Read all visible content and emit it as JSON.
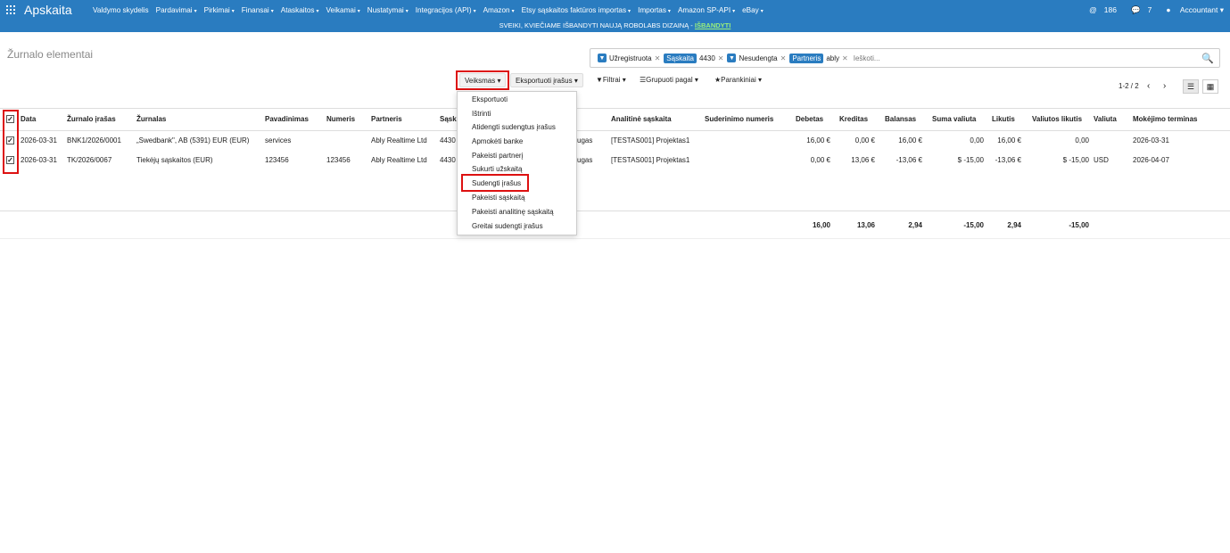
{
  "topbar": {
    "app_title": "Apskaita",
    "menu": [
      "Valdymo skydelis",
      "Pardavimai",
      "Pirkimai",
      "Finansai",
      "Ataskaitos",
      "Veikamai",
      "Nustatymai",
      "Integracijos (API)",
      "Amazon",
      "Etsy sąskaitos faktūros importas",
      "Importas",
      "Amazon SP-API",
      "eBay"
    ],
    "notifications": "186",
    "messages": "7",
    "user": "Accountant"
  },
  "banner": {
    "text": "SVEIKI, KVIEČIAME IŠBANDYTI NAUJĄ ROBOLABS DIZAINĄ -",
    "link": "IŠBANDYTI"
  },
  "page": {
    "breadcrumb": "Žurnalo elementai"
  },
  "search": {
    "facets": [
      {
        "type": "filter",
        "value": "Užregistruota"
      },
      {
        "type": "field",
        "label": "Sąskaita",
        "value": "4430"
      },
      {
        "type": "filter",
        "value": "Nesudengta"
      },
      {
        "type": "field",
        "label": "Partneris",
        "value": "ably"
      }
    ],
    "placeholder": "Ieškoti..."
  },
  "toolbar": {
    "actions": "Veiksmas",
    "export": "Eksportuoti įrašus",
    "filters": "Filtrai",
    "group_by": "Grupuoti pagal",
    "favorites": "Parankiniai"
  },
  "pager": {
    "text": "1-2 / 2"
  },
  "table": {
    "headers": {
      "date": "Data",
      "entry": "Žurnalo įrašas",
      "journal": "Žurnalas",
      "name": "Pavadinimas",
      "number": "Numeris",
      "partner": "Partneris",
      "account": "Sąsk",
      "analytic": "Analitinė sąskaita",
      "reconcile": "Suderinimo numeris",
      "debit": "Debetas",
      "credit": "Kreditas",
      "balance": "Balansas",
      "amount_currency": "Suma valiuta",
      "residual": "Likutis",
      "residual_currency": "Valiutos likutis",
      "currency": "Valiuta",
      "due": "Mokėjimo terminas"
    },
    "rows": [
      {
        "date": "2026-03-31",
        "entry": "BNK1/2026/0001",
        "journal": "„Swedbank\", AB (5391) EUR (EUR)",
        "name": "services",
        "number": "",
        "partner": "Ably Realtime Ltd",
        "account": "4430",
        "account_tail": "ugas",
        "analytic": "[TESTAS001] Projektas1",
        "reconcile": "",
        "debit": "16,00 €",
        "credit": "0,00 €",
        "balance": "16,00 €",
        "amount_currency": "0,00",
        "residual": "16,00 €",
        "residual_currency": "0,00",
        "currency": "",
        "due": "2026-03-31"
      },
      {
        "date": "2026-03-31",
        "entry": "TK/2026/0067",
        "journal": "Tiekėjų sąskaitos (EUR)",
        "name": "123456",
        "number": "123456",
        "partner": "Ably Realtime Ltd",
        "account": "4430",
        "account_tail": "ugas",
        "analytic": "[TESTAS001] Projektas1",
        "reconcile": "",
        "debit": "0,00 €",
        "credit": "13,06 €",
        "balance": "-13,06 €",
        "amount_currency": "$ -15,00",
        "residual": "-13,06 €",
        "residual_currency": "$ -15,00",
        "currency": "USD",
        "due": "2026-04-07"
      }
    ],
    "totals": {
      "debit": "16,00",
      "credit": "13,06",
      "balance": "2,94",
      "amount_currency": "-15,00",
      "residual": "2,94",
      "residual_currency": "-15,00"
    }
  },
  "actions_menu": [
    "Eksportuoti",
    "Ištrinti",
    "Atidengti sudengtus įrašus",
    "Apmokėti banke",
    "Pakeisti partnerį",
    "Sukurti užskaitą",
    "Sudengti įrašus",
    "Pakeisti sąskaitą",
    "Pakeisti analitinę sąskaitą",
    "Greitai sudengti įrašus"
  ],
  "colors": {
    "header_blue": "#2a7cc0",
    "highlight_red": "#d11"
  }
}
